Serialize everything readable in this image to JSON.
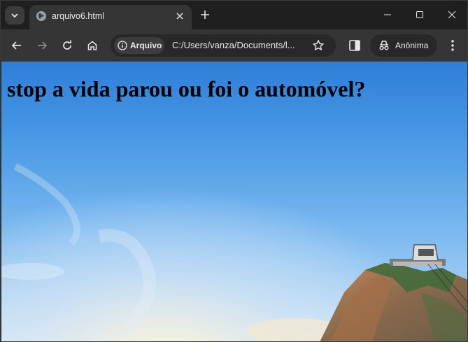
{
  "browser": {
    "tab": {
      "title": "arquivo6.html"
    },
    "omnibox": {
      "security_chip": "Arquivo",
      "url": "C:/Users/vanza/Documents/l..."
    },
    "profile": {
      "label": "Anônima"
    },
    "icons": [
      "tab-search-icon",
      "globe-icon",
      "close-icon",
      "plus-icon",
      "minimize-icon",
      "maximize-icon",
      "window-close-icon",
      "back-icon",
      "forward-icon",
      "reload-icon",
      "home-icon",
      "info-icon",
      "star-icon",
      "side-panel-icon",
      "incognito-icon",
      "kebab-menu-icon"
    ]
  },
  "page": {
    "heading": "stop a vida parou ou foi o automóvel?"
  },
  "colors": {
    "frame": "#1f1f1f",
    "toolbar": "#353535",
    "omnibox": "#282828",
    "sky_top": "#2f7ed8",
    "sky_bottom": "#c6dff3"
  }
}
